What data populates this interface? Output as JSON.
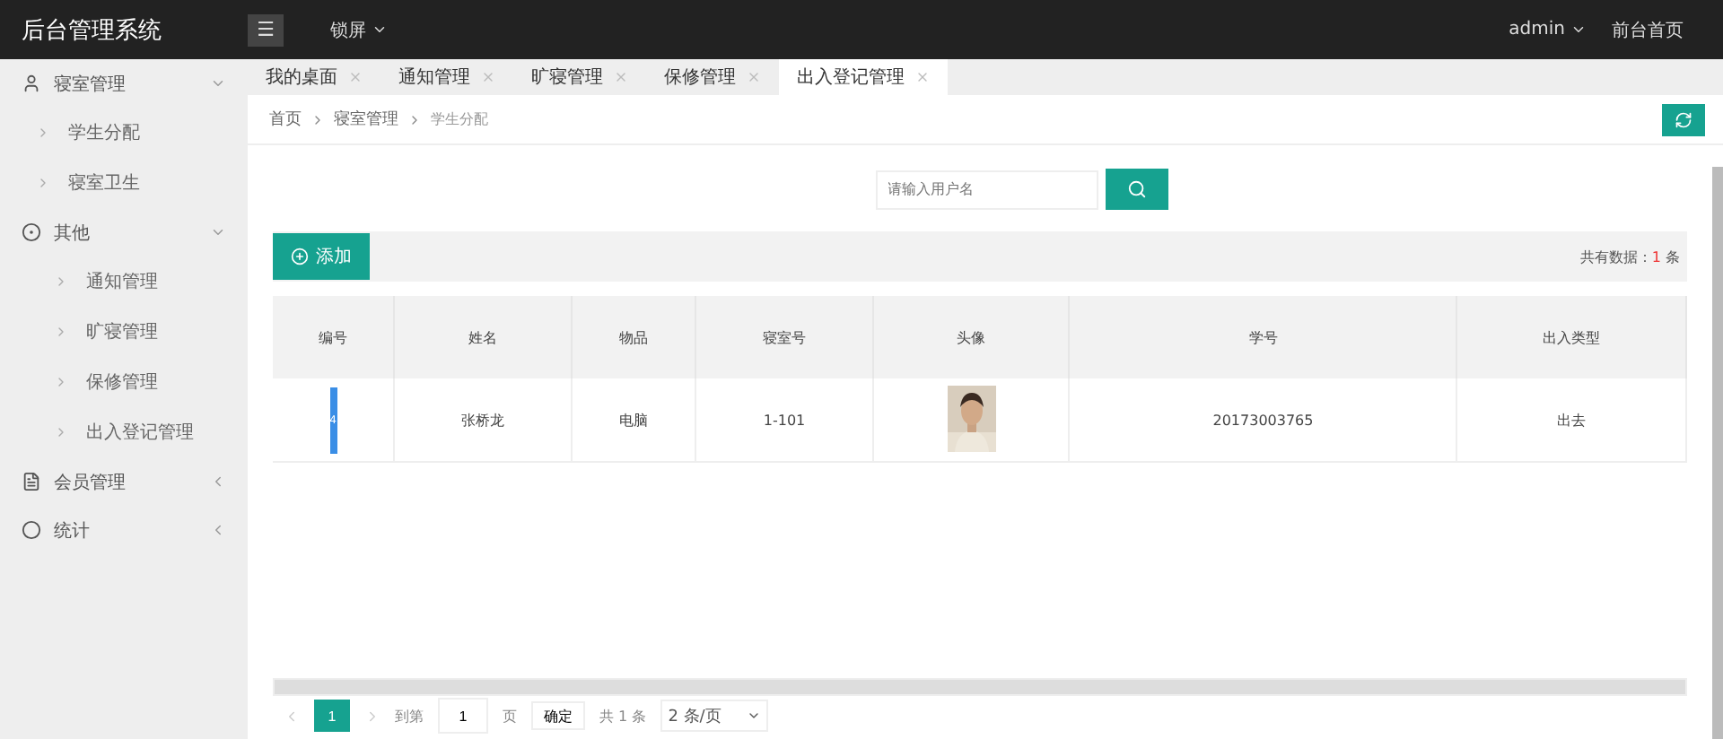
{
  "header": {
    "logo": "后台管理系统",
    "menu_icon": "☰",
    "lock": "锁屏",
    "user": "admin",
    "home_link": "前台首页"
  },
  "sidebar": {
    "items": [
      {
        "label": "寝室管理",
        "expanded": true,
        "children": [
          {
            "label": "学生分配"
          },
          {
            "label": "寝室卫生"
          }
        ]
      },
      {
        "label": "其他",
        "expanded": true,
        "children": [
          {
            "label": "通知管理"
          },
          {
            "label": "旷寝管理"
          },
          {
            "label": "保修管理"
          },
          {
            "label": "出入登记管理"
          }
        ]
      },
      {
        "label": "会员管理",
        "expanded": false
      },
      {
        "label": "统计",
        "expanded": false
      }
    ]
  },
  "tabs": [
    {
      "label": "我的桌面",
      "selected": false
    },
    {
      "label": "通知管理",
      "selected": false
    },
    {
      "label": "旷寝管理",
      "selected": false
    },
    {
      "label": "保修管理",
      "selected": false
    },
    {
      "label": "出入登记管理",
      "selected": true
    }
  ],
  "breadcrumb": [
    "首页",
    "寝室管理",
    "学生分配"
  ],
  "search": {
    "placeholder": "请输入用户名"
  },
  "toolbar": {
    "add_button": "添加",
    "total_label": "共有数据：",
    "total_count": "1",
    "total_unit": "条"
  },
  "table": {
    "columns": [
      "编号",
      "姓名",
      "物品",
      "寝室号",
      "头像",
      "学号",
      "出入类型"
    ],
    "rows": [
      {
        "id": "4",
        "name": "张桥龙",
        "item": "电脑",
        "room": "1-101",
        "student_no": "20173003765",
        "type": "出去"
      }
    ]
  },
  "pagination": {
    "pages": [
      {
        "label": "1",
        "selected": true
      }
    ],
    "goto_label": "到第",
    "goto_value": "1",
    "page_label": "页",
    "confirm": "确定",
    "total": "共 1 条",
    "page_size": "2 条/页"
  }
}
